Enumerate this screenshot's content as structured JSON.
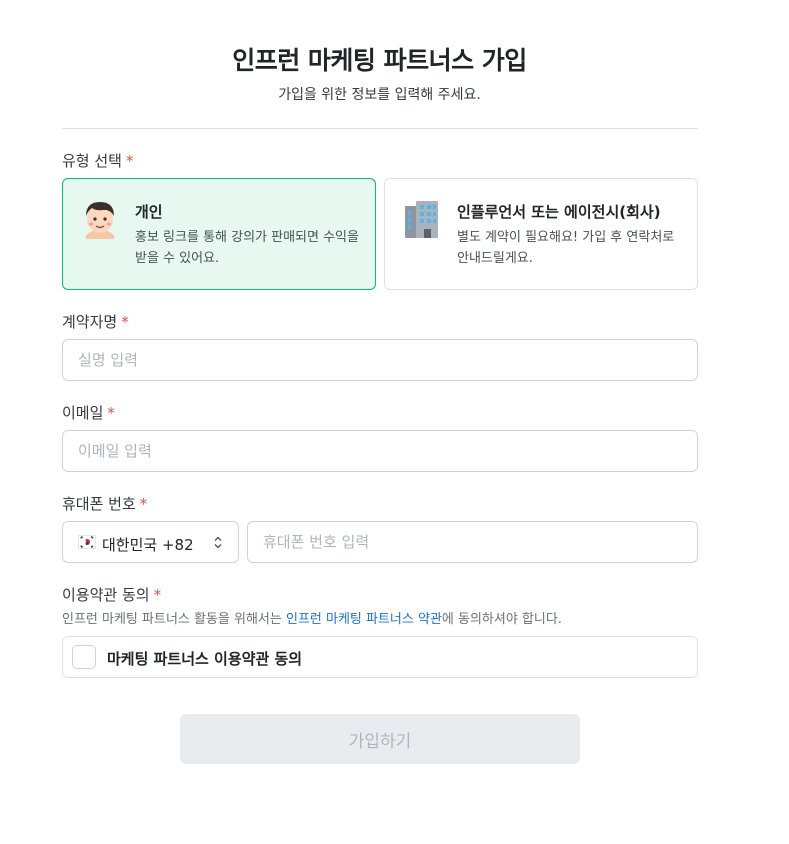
{
  "header": {
    "title": "인프런 마케팅 파트너스 가입",
    "subtitle": "가입을 위한 정보를 입력해 주세요."
  },
  "required_mark": "*",
  "type_section": {
    "label": "유형 선택",
    "options": [
      {
        "icon": "person-avatar-icon",
        "title": "개인",
        "description": "홍보 링크를 통해 강의가 판매되면 수익을\n받을 수 있어요.",
        "selected": true
      },
      {
        "icon": "office-building-icon",
        "title": "인플루언서 또는 에이전시(회사)",
        "description": "별도 계약이 필요해요! 가입 후 연락처로\n안내드릴게요.",
        "selected": false
      }
    ]
  },
  "name_field": {
    "label": "계약자명",
    "placeholder": "실명 입력",
    "value": ""
  },
  "email_field": {
    "label": "이메일",
    "placeholder": "이메일 입력",
    "value": ""
  },
  "phone_field": {
    "label": "휴대폰 번호",
    "country": {
      "flag": "south-korea-flag-icon",
      "label": "대한민국 +82"
    },
    "placeholder": "휴대폰 번호 입력",
    "value": ""
  },
  "terms": {
    "label": "이용약관 동의",
    "desc_prefix": "인프런 마케팅 파트너스 활동을 위해서는 ",
    "link_text": "인프런 마케팅 파트너스 약관",
    "desc_suffix": "에 동의하셔야 합니다.",
    "checkbox_label": "마케팅 파트너스 이용약관 동의",
    "checked": false
  },
  "submit": {
    "label": "가입하기",
    "enabled": false
  },
  "colors": {
    "accent": "#00c471",
    "selected_bg": "#e6f8ef",
    "required": "#e5503c",
    "link": "#1a73c9",
    "disabled_bg": "#e9ecef",
    "disabled_text": "#adb5bd"
  }
}
